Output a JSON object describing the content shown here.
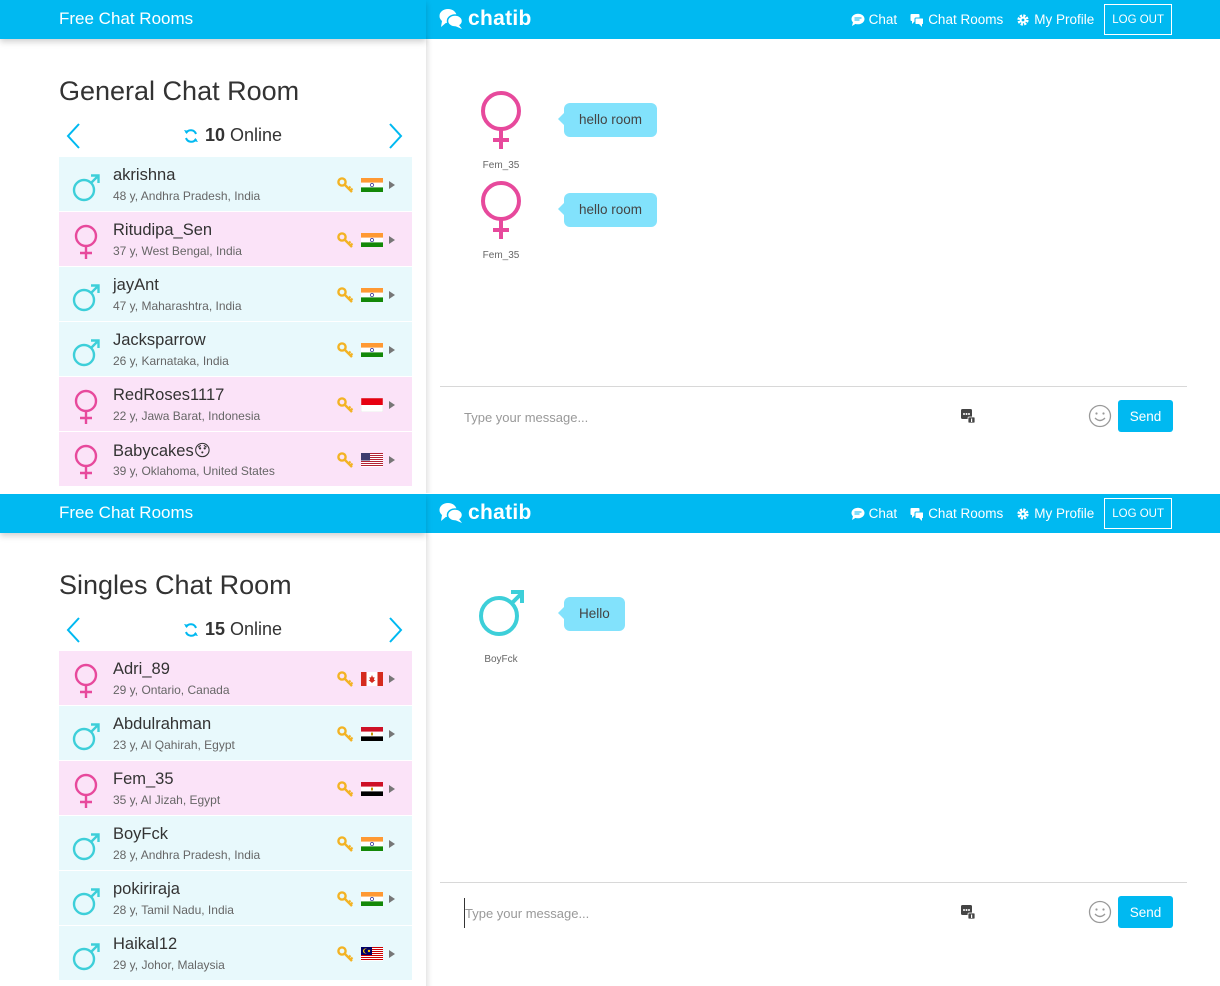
{
  "colors": {
    "accent": "#00b9f1",
    "male": "#3dcfd9",
    "female": "#e7499c",
    "key": "#f3b324",
    "bubble": "#82e2fc"
  },
  "panels": [
    {
      "header": {
        "site_title": "Free Chat Rooms",
        "brand": "chatib",
        "nav": [
          {
            "label": "Chat",
            "icon": "chat-bubble-icon"
          },
          {
            "label": "Chat Rooms",
            "icon": "chat-rooms-icon"
          },
          {
            "label": "My Profile",
            "icon": "gear-icon"
          }
        ],
        "logout": "LOG OUT"
      },
      "room": {
        "title": "General Chat Room",
        "online_count": "10",
        "online_label": "Online"
      },
      "users": [
        {
          "name": "akrishna",
          "info": "48 y, Andhra Pradesh, India",
          "gender": "male",
          "country": "india"
        },
        {
          "name": "Ritudipa_Sen",
          "info": "37 y, West Bengal, India",
          "gender": "female",
          "country": "india"
        },
        {
          "name": "jayAnt",
          "info": "47 y, Maharashtra, India",
          "gender": "male",
          "country": "india"
        },
        {
          "name": "Jacksparrow",
          "info": "26 y, Karnataka, India",
          "gender": "male",
          "country": "india"
        },
        {
          "name": "RedRoses1117",
          "info": "22 y, Jawa Barat, Indonesia",
          "gender": "female",
          "country": "indonesia"
        },
        {
          "name": "Babycakes😯",
          "info": "39 y, Oklahoma, United States",
          "gender": "female",
          "country": "usa"
        }
      ],
      "messages": [
        {
          "user": "Fem_35",
          "text": "hello room",
          "gender": "female"
        },
        {
          "user": "Fem_35",
          "text": "hello room",
          "gender": "female"
        }
      ],
      "composer": {
        "placeholder": "Type your message...",
        "send": "Send",
        "focused": false
      }
    },
    {
      "header": {
        "site_title": "Free Chat Rooms",
        "brand": "chatib",
        "nav": [
          {
            "label": "Chat",
            "icon": "chat-bubble-icon"
          },
          {
            "label": "Chat Rooms",
            "icon": "chat-rooms-icon"
          },
          {
            "label": "My Profile",
            "icon": "gear-icon"
          }
        ],
        "logout": "LOG OUT"
      },
      "room": {
        "title": "Singles Chat Room",
        "online_count": "15",
        "online_label": "Online"
      },
      "users": [
        {
          "name": "Adri_89",
          "info": "29 y, Ontario, Canada",
          "gender": "female",
          "country": "canada"
        },
        {
          "name": "Abdulrahman",
          "info": "23 y, Al Qahirah, Egypt",
          "gender": "male",
          "country": "egypt"
        },
        {
          "name": "Fem_35",
          "info": "35 y, Al Jizah, Egypt",
          "gender": "female",
          "country": "egypt"
        },
        {
          "name": "BoyFck",
          "info": "28 y, Andhra Pradesh, India",
          "gender": "male",
          "country": "india"
        },
        {
          "name": "pokiriraja",
          "info": "28 y, Tamil Nadu, India",
          "gender": "male",
          "country": "india"
        },
        {
          "name": "Haikal12",
          "info": "29 y, Johor, Malaysia",
          "gender": "male",
          "country": "malaysia"
        }
      ],
      "messages": [
        {
          "user": "BoyFck",
          "text": "Hello",
          "gender": "male"
        }
      ],
      "composer": {
        "placeholder": "Type your message...",
        "send": "Send",
        "focused": true
      }
    }
  ]
}
